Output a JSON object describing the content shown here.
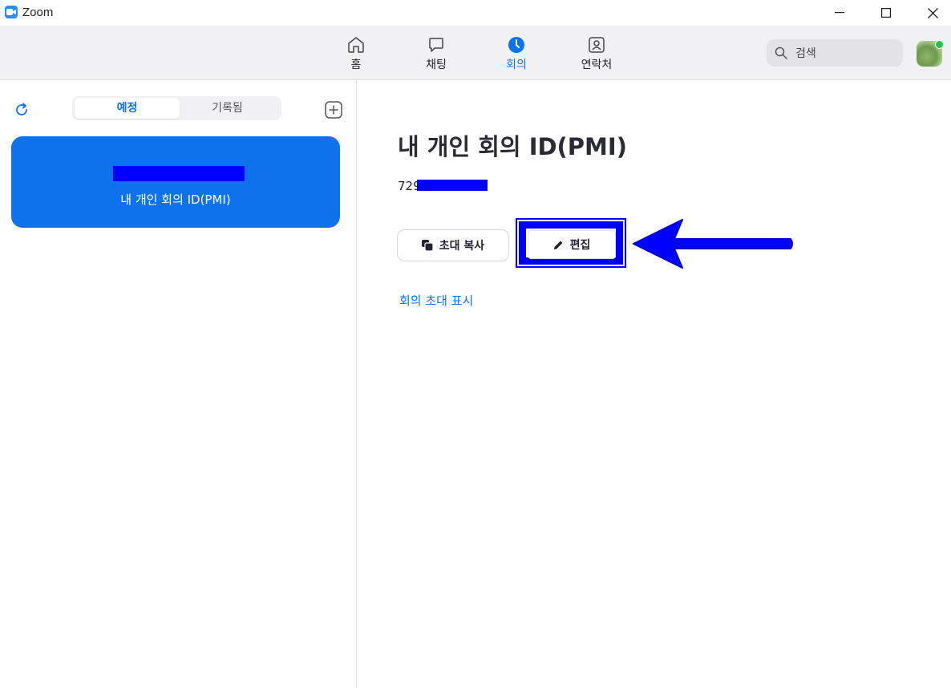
{
  "window": {
    "title": "Zoom",
    "icon": "zoom-camera-icon",
    "controls": [
      "minimize-icon",
      "maximize-icon",
      "close-icon"
    ]
  },
  "nav": {
    "items": [
      {
        "label": "홈",
        "icon": "home-icon",
        "active": false
      },
      {
        "label": "채팅",
        "icon": "chat-icon",
        "active": false
      },
      {
        "label": "회의",
        "icon": "clock-icon",
        "active": true
      },
      {
        "label": "연락처",
        "icon": "contacts-icon",
        "active": false
      }
    ],
    "search_placeholder": "검색",
    "presence_color": "#23c552"
  },
  "sidebar": {
    "tabs": [
      {
        "label": "예정",
        "active": true
      },
      {
        "label": "기록됨",
        "active": false
      }
    ],
    "meeting_card": {
      "label": "내 개인 회의 ID(PMI)",
      "color": "#0E72ED"
    }
  },
  "main": {
    "title": "내 개인 회의 ID(PMI)",
    "meeting_id_prefix": "729",
    "copy_invite_label": "초대 복사",
    "edit_label": "편집",
    "show_invite_label": "회의 초대 표시"
  },
  "colors": {
    "accent": "#0E72ED",
    "annotation": "#0000ff"
  }
}
